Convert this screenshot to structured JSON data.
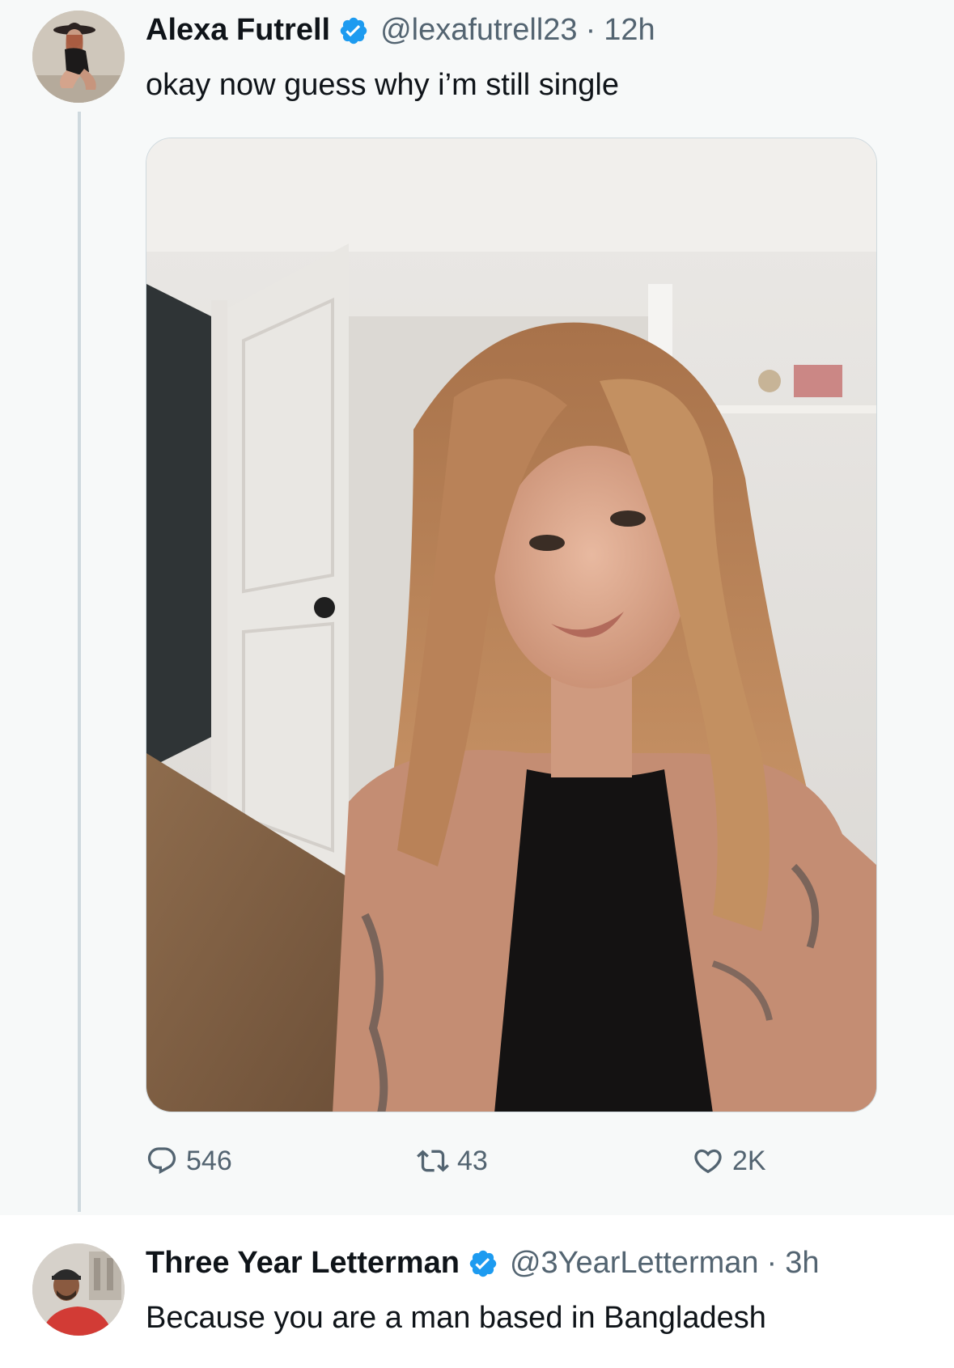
{
  "tweet": {
    "author_name": "Alexa Futrell",
    "handle": "@lexafutrell23",
    "separator": "·",
    "time": "12h",
    "text": "okay now guess why i’m still single",
    "verified_badge_icon": "verified-badge-icon",
    "photo_description_icon": "photo",
    "stats": {
      "replies": "546",
      "reposts": "43",
      "likes": "2K"
    }
  },
  "reply": {
    "author_name": "Three Year Letterman",
    "handle": "@3YearLetterman",
    "separator": "·",
    "time": "3h",
    "text": "Because you are a man based in Bangladesh",
    "verified_badge_icon": "verified-badge-icon"
  },
  "colors": {
    "verified": "#1d9bf0",
    "secondary_text": "#536471",
    "primary_text": "#0f1419",
    "thread_line": "#cfd9de",
    "tweet_background": "#f7f9f9"
  }
}
